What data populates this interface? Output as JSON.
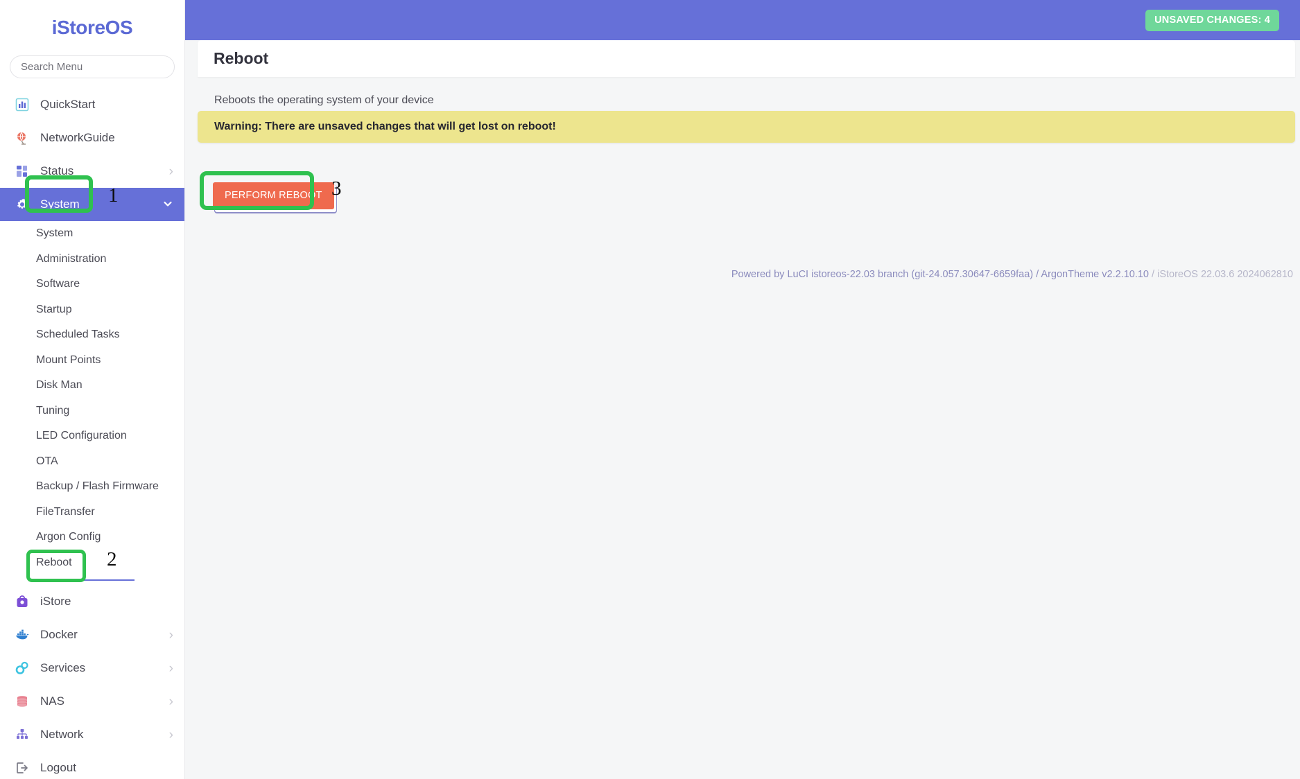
{
  "brand": {
    "name": "iStoreOS"
  },
  "search": {
    "placeholder": "Search Menu",
    "value": ""
  },
  "sidebar": {
    "items": [
      {
        "label": "QuickStart",
        "icon": "chart-bar-icon",
        "chevron": ""
      },
      {
        "label": "NetworkGuide",
        "icon": "globe-icon",
        "chevron": ""
      },
      {
        "label": "Status",
        "icon": "grid-squares-icon",
        "chevron": "›"
      },
      {
        "label": "System",
        "icon": "gear-icon",
        "chevron": "⌄",
        "active": true
      },
      {
        "label": "iStore",
        "icon": "shopping-bag-icon",
        "chevron": ""
      },
      {
        "label": "Docker",
        "icon": "docker-whale-icon",
        "chevron": "›"
      },
      {
        "label": "Services",
        "icon": "gears-icon",
        "chevron": "›"
      },
      {
        "label": "NAS",
        "icon": "database-icon",
        "chevron": "›"
      },
      {
        "label": "Network",
        "icon": "sitemap-icon",
        "chevron": "›"
      },
      {
        "label": "Logout",
        "icon": "logout-icon",
        "chevron": ""
      }
    ],
    "system_submenu": [
      {
        "label": "System"
      },
      {
        "label": "Administration"
      },
      {
        "label": "Software"
      },
      {
        "label": "Startup"
      },
      {
        "label": "Scheduled Tasks"
      },
      {
        "label": "Mount Points"
      },
      {
        "label": "Disk Man"
      },
      {
        "label": "Tuning"
      },
      {
        "label": "LED Configuration"
      },
      {
        "label": "OTA"
      },
      {
        "label": "Backup / Flash Firmware"
      },
      {
        "label": "FileTransfer"
      },
      {
        "label": "Argon Config"
      },
      {
        "label": "Reboot",
        "current": true
      }
    ]
  },
  "header": {
    "unsaved_badge": "UNSAVED CHANGES: 4"
  },
  "page": {
    "title": "Reboot",
    "description": "Reboots the operating system of your device",
    "warning": "Warning: There are unsaved changes that will get lost on reboot!",
    "perform_button": "PERFORM REBOOT"
  },
  "footer": {
    "powered_by": "Powered by LuCI istoreos-22.03 branch (git-24.057.30647-6659faa)",
    "separator1": " / ",
    "theme": "ArgonTheme v2.2.10.10",
    "separator2": " / ",
    "version": "iStoreOS 22.03.6 2024062810"
  },
  "annotations": {
    "step1": "1",
    "step2": "2",
    "step3": "3"
  },
  "colors": {
    "accent": "#6670d8",
    "badge_green": "#6fd79a",
    "warning_bg": "#ede58e",
    "danger": "#ef6a4e",
    "highlight": "#2fc14f"
  }
}
